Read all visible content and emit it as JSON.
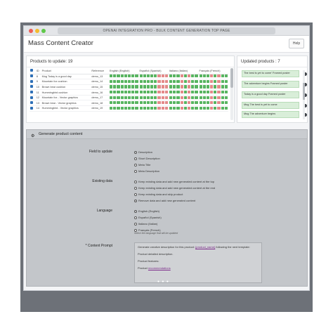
{
  "window": {
    "url_title": "OPENAI INTEGRATION PRO - BULK CONTENT GENERATION TOP PAGE"
  },
  "app": {
    "title": "Mass Content Creator",
    "help_label": "Help"
  },
  "products_panel": {
    "title": "Products to update: 19",
    "columns": [
      "ID",
      "Product",
      "Reference",
      "English (English)",
      "Español (Spanish)",
      "Italiano (Italian)",
      "Français (French)"
    ],
    "rows": [
      {
        "id": "8",
        "name": "Mug Today is a good day",
        "ref": "demo_13",
        "langs": [
          "gggggggg",
          "gggggrrr",
          "gggrgrgg",
          "gggrgrgg"
        ]
      },
      {
        "id": "9",
        "name": "Mountain fox cushion",
        "ref": "demo_14",
        "langs": [
          "gggggggg",
          "gggggrrr",
          "gggrgrgg",
          "gggrgrgg"
        ]
      },
      {
        "id": "10",
        "name": "Brown bear cushion",
        "ref": "demo_15",
        "langs": [
          "gggggggg",
          "gggggrrr",
          "gggrgrgg",
          "gggrgrgg"
        ]
      },
      {
        "id": "11",
        "name": "Hummingbird cushion",
        "ref": "demo_16",
        "langs": [
          "gggggggg",
          "gggggrrr",
          "gggrgrgg",
          "gggrgrgg"
        ]
      },
      {
        "id": "12",
        "name": "Mountain fox - Vector graphics",
        "ref": "demo_17",
        "langs": [
          "gggggggg",
          "gggggrrr",
          "gggrgrgg",
          "gggrgrgg"
        ]
      },
      {
        "id": "13",
        "name": "Brown bear - Vector graphics",
        "ref": "demo_18",
        "langs": [
          "gggggggg",
          "gggggrrr",
          "gggrgrgg",
          "gggrgrgg"
        ]
      },
      {
        "id": "14",
        "name": "Hummingbird - Vector graphics",
        "ref": "demo_19",
        "langs": [
          "gggggggg",
          "gggggrrr",
          "gggrgrgg",
          "gggrgrgg"
        ]
      }
    ]
  },
  "updated_panel": {
    "title": "Updated products : 7",
    "items": [
      "The best is yet to come' Framed poster",
      "The adventure begins Framed poster",
      "Today is a good day Framed poster",
      "Mug The best is yet to come",
      "Mug The adventure begins"
    ]
  },
  "generate": {
    "title": "Generate product content",
    "field_label": "Field to update",
    "field_options": [
      "Description",
      "Short Description",
      "Meta Title",
      "Meta Description"
    ],
    "field_selected": 0,
    "existing_label": "Existing data",
    "existing_options": [
      "Keep existing data and add new generated content at the top",
      "Keep existing data and add new generated content at the end",
      "Keep existing data and skip product",
      "Remove data and add new generated content"
    ],
    "existing_selected": 3,
    "language_label": "Language",
    "language_options": [
      "English (English)",
      "Español (Spanish)",
      "Italiano (Italian)",
      "Français (French)"
    ],
    "language_selected": 0,
    "language_hint": "Select the language that will be updated",
    "prompt_label": "* Content Prompt",
    "prompt_line1_pre": "Generate creative description for this product: ",
    "prompt_line1_var": "{product_name}",
    "prompt_line1_post": " following the next template:",
    "prompt_line2": "Product detailed description.",
    "prompt_line3": "Product features:",
    "prompt_line4_pre": "Product ",
    "prompt_line4_var": "recommendations"
  },
  "carousel": {
    "dots": "● ● ●"
  }
}
